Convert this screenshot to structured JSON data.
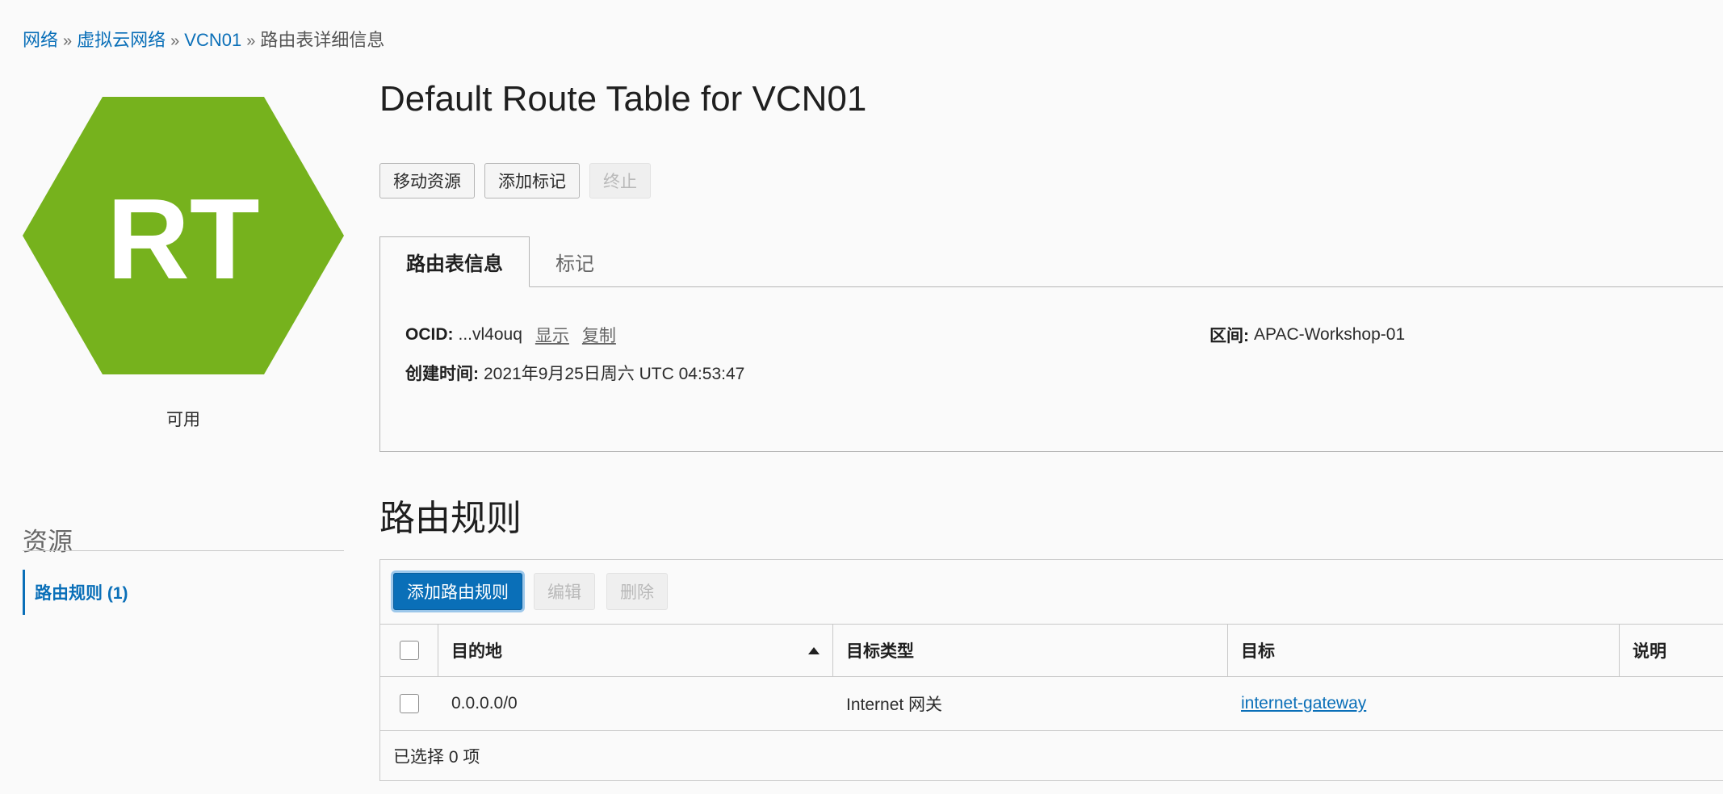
{
  "breadcrumb": {
    "items": [
      "网络",
      "虚拟云网络",
      "VCN01"
    ],
    "separator": "»",
    "current": "路由表详细信息"
  },
  "resource_icon": {
    "letters": "RT",
    "color": "#76b21d",
    "icon": "hexagon-icon"
  },
  "status": "可用",
  "title": "Default Route Table for VCN01",
  "actions": {
    "move": "移动资源",
    "add_tag": "添加标记",
    "terminate": "终止"
  },
  "tabs": [
    {
      "label": "路由表信息",
      "active": true
    },
    {
      "label": "标记",
      "active": false
    }
  ],
  "info": {
    "ocid_label": "OCID:",
    "ocid_value": "...vl4ouq",
    "show": "显示",
    "copy": "复制",
    "compartment_label": "区间:",
    "compartment_value": "APAC-Workshop-01",
    "created_label": "创建时间:",
    "created_value": "2021年9月25日周六 UTC 04:53:47"
  },
  "resources": {
    "title": "资源",
    "items": [
      {
        "label": "路由规则 (1)",
        "active": true
      }
    ]
  },
  "rules": {
    "title": "路由规则",
    "toolbar": {
      "add": "添加路由规则",
      "edit": "编辑",
      "delete": "删除"
    },
    "columns": [
      "目的地",
      "目标类型",
      "目标",
      "说明"
    ],
    "rows": [
      {
        "destination": "0.0.0.0/0",
        "target_type": "Internet 网关",
        "target": "internet-gateway",
        "description": ""
      }
    ],
    "selected_text": "已选择 0 项"
  },
  "colors": {
    "accent": "#0a6fb8",
    "hexagon": "#76b21d"
  }
}
